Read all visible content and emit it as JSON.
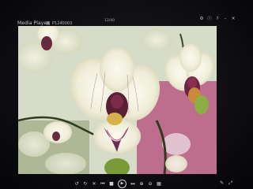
{
  "window": {
    "app_title": "Media Player",
    "file_name": "P1240003",
    "counter": "12/40"
  },
  "top_icons": [
    "settings-icon",
    "info-icon",
    "help-icon",
    "minimize-icon",
    "close-icon"
  ],
  "controls": {
    "items": [
      "rotate-left-icon",
      "rotate-right-icon",
      "delete-icon",
      "skip-previous-icon",
      "stop-icon",
      "play-icon",
      "next-icon",
      "zoom-in-icon",
      "zoom-out-icon",
      "slideshow-icon"
    ],
    "right_items": [
      "edit-icon",
      "fullscreen-icon"
    ]
  },
  "colors": {
    "background": "#0b0b0e",
    "control_fg": "#cfcfd6",
    "petal": "#f3f0de",
    "lip": "#5a1f35",
    "pink_bg": "#b4567e",
    "stem": "#2f3a1f"
  }
}
